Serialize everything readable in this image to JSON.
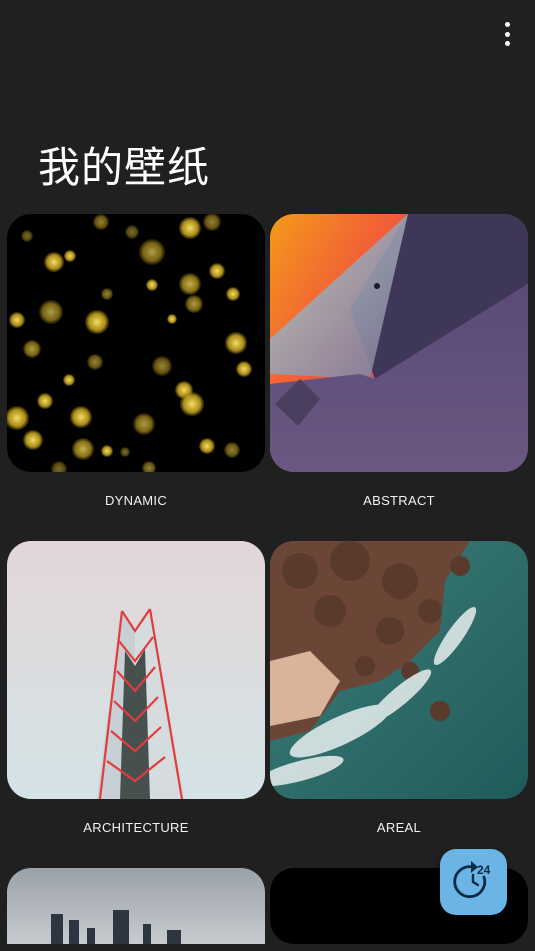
{
  "header": {
    "title": "我的壁纸",
    "menu_icon": "more-vert-icon"
  },
  "categories": [
    {
      "label": "DYNAMIC"
    },
    {
      "label": "ABSTRACT"
    },
    {
      "label": "ARCHITECTURE"
    },
    {
      "label": "AREAL"
    },
    {
      "label": ""
    },
    {
      "label": ""
    }
  ],
  "fab": {
    "icon": "timer-refresh-icon",
    "badge": "24",
    "color": "#6bb4e6"
  },
  "colors": {
    "background": "#202020",
    "text": "#ffffff"
  }
}
